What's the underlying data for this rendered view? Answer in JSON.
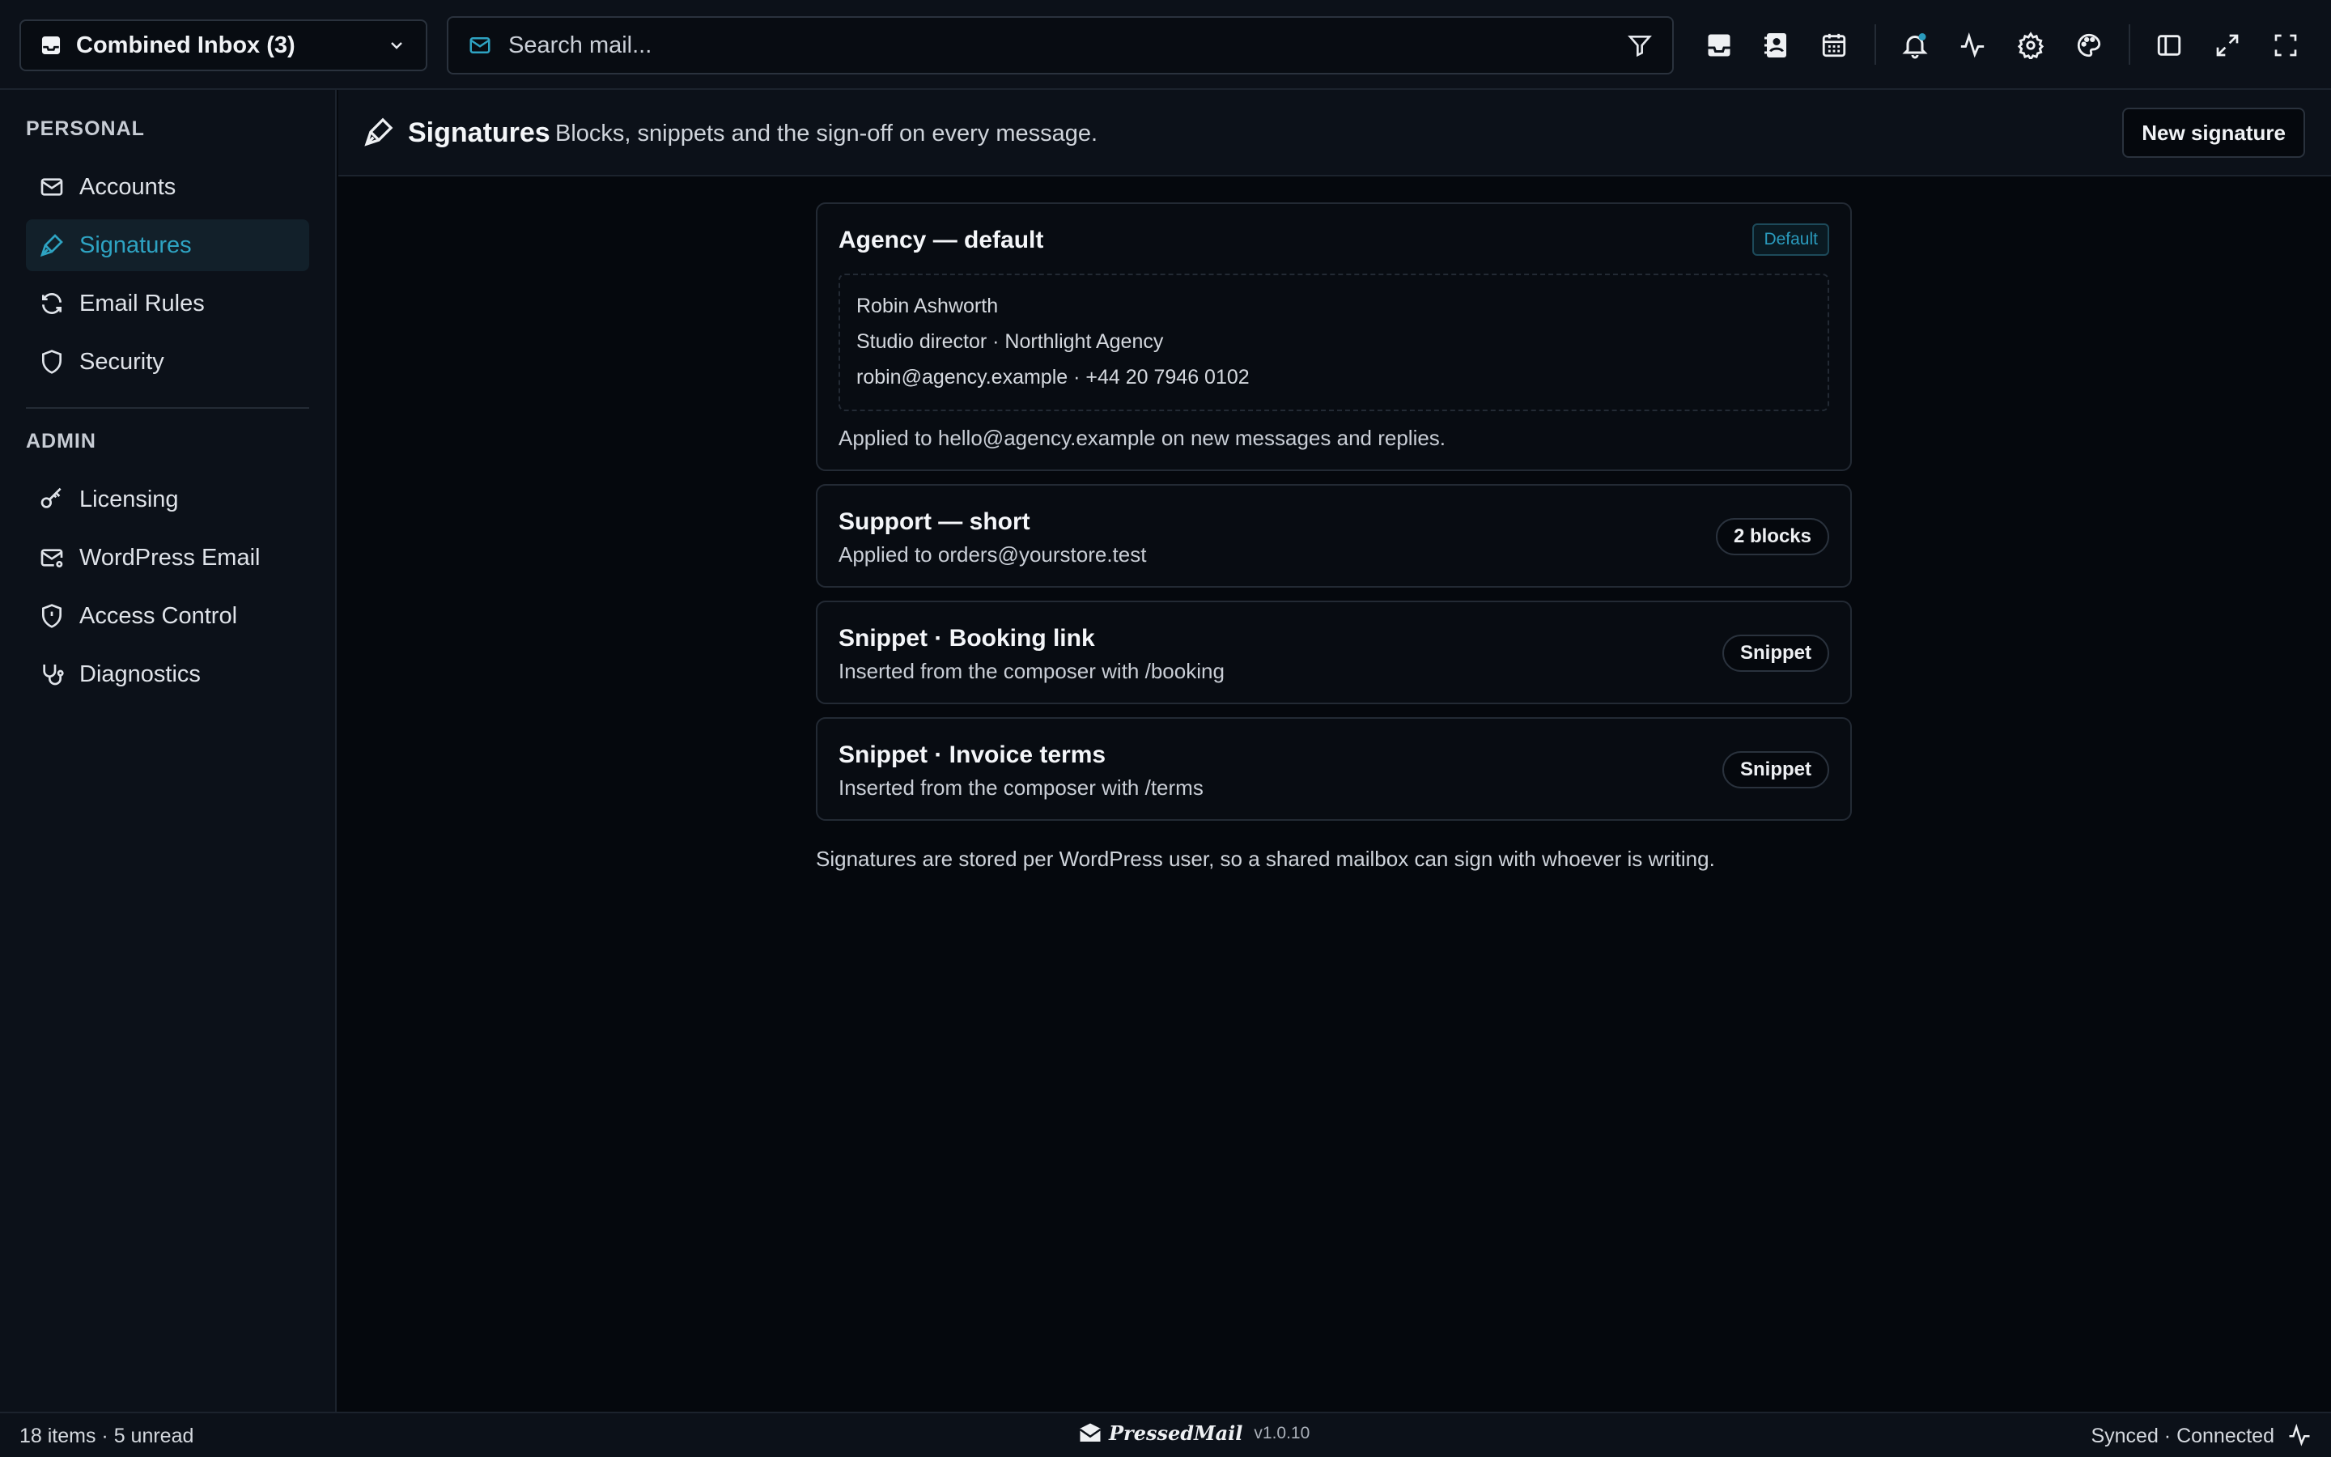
{
  "topbar": {
    "inbox_label": "Combined Inbox (3)",
    "search_placeholder": "Search mail...",
    "icons": [
      "inbox-icon",
      "contacts-icon",
      "calendar-icon",
      "bell-icon",
      "activity-icon",
      "gear-icon",
      "palette-icon",
      "sidebar-toggle-icon",
      "expand-icon",
      "fullscreen-icon"
    ]
  },
  "sidebar": {
    "personal_title": "PERSONAL",
    "admin_title": "ADMIN",
    "personal_items": [
      {
        "label": "Accounts",
        "icon": "mail-icon"
      },
      {
        "label": "Signatures",
        "icon": "pen-icon",
        "active": true
      },
      {
        "label": "Email Rules",
        "icon": "refresh-icon"
      },
      {
        "label": "Security",
        "icon": "shield-icon"
      }
    ],
    "admin_items": [
      {
        "label": "Licensing",
        "icon": "key-icon"
      },
      {
        "label": "WordPress Email",
        "icon": "mail-settings-icon"
      },
      {
        "label": "Access Control",
        "icon": "shield-alert-icon"
      },
      {
        "label": "Diagnostics",
        "icon": "stethoscope-icon"
      }
    ]
  },
  "main": {
    "title": "Signatures",
    "description": "Blocks, snippets and the sign-off on every message.",
    "new_button": "New signature",
    "cards": [
      {
        "title": "Agency — default",
        "badge": "Default",
        "preview": {
          "name": "Robin Ashworth",
          "role": "Studio director · Northlight Agency",
          "contact": "robin@agency.example · +44 20 7946 0102"
        },
        "note": "Applied to hello@agency.example on new messages and replies."
      },
      {
        "title": "Support — short",
        "subtitle": "Applied to orders@yourstore.test",
        "pill": "2 blocks"
      },
      {
        "title": "Snippet · Booking link",
        "subtitle": "Inserted from the composer with /booking",
        "pill": "Snippet"
      },
      {
        "title": "Snippet · Invoice terms",
        "subtitle": "Inserted from the composer with /terms",
        "pill": "Snippet"
      }
    ],
    "footnote": "Signatures are stored per WordPress user, so a shared mailbox can sign with whoever is writing."
  },
  "statusbar": {
    "counts": "18 items · 5 unread",
    "brand": "PressedMail",
    "version": "v1.0.10",
    "status": "Synced · Connected"
  },
  "colors": {
    "background": "#05080d",
    "panel": "#0c1119",
    "accent": "#2ea3c2",
    "notification_dot": "#2a9bbd"
  }
}
